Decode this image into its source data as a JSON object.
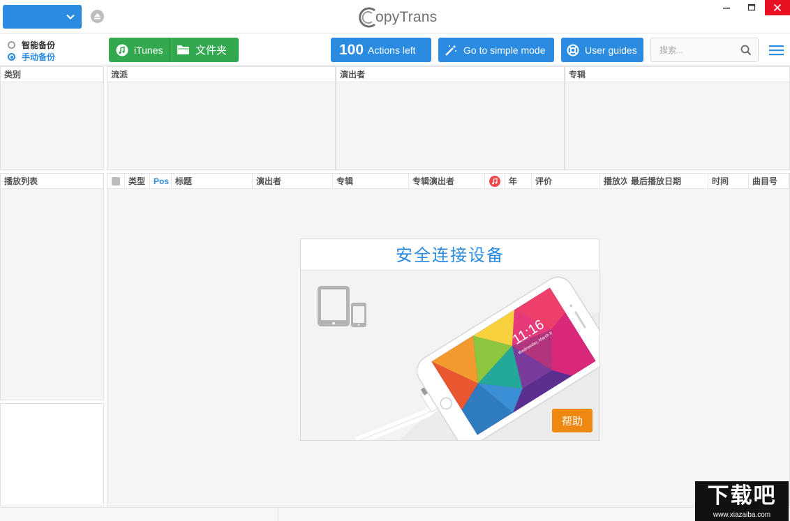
{
  "app": {
    "logo_text": "opyTrans"
  },
  "toolbar": {
    "radio_smart": "智能备份",
    "radio_manual": "手动备份",
    "itunes_label": "iTunes",
    "folder_label": "文件夹",
    "actions_count": "100",
    "actions_label": "Actions left",
    "simple_mode_label": "Go to simple mode",
    "user_guides_label": "User guides",
    "search_placeholder": "搜索..."
  },
  "panels": {
    "category": "类别",
    "genre": "流派",
    "artist": "演出者",
    "album": "专辑",
    "playlist": "播放列表"
  },
  "tracks": {
    "columns": [
      "类型",
      "Pos",
      "标题",
      "演出者",
      "专辑",
      "专辑演出者",
      "年",
      "评价",
      "播放次数",
      "最后播放日期",
      "时间",
      "曲目号"
    ]
  },
  "connect": {
    "title": "安全连接设备",
    "help_label": "帮助",
    "phone_time": "11:16",
    "phone_date": "Wednesday, March 8"
  },
  "watermark": {
    "main": "下载吧",
    "sub": "www.xiazaiba.com"
  },
  "colors": {
    "accent_blue": "#2a8be0",
    "green": "#33a84f",
    "orange": "#ef8811",
    "close_red": "#e81123"
  }
}
